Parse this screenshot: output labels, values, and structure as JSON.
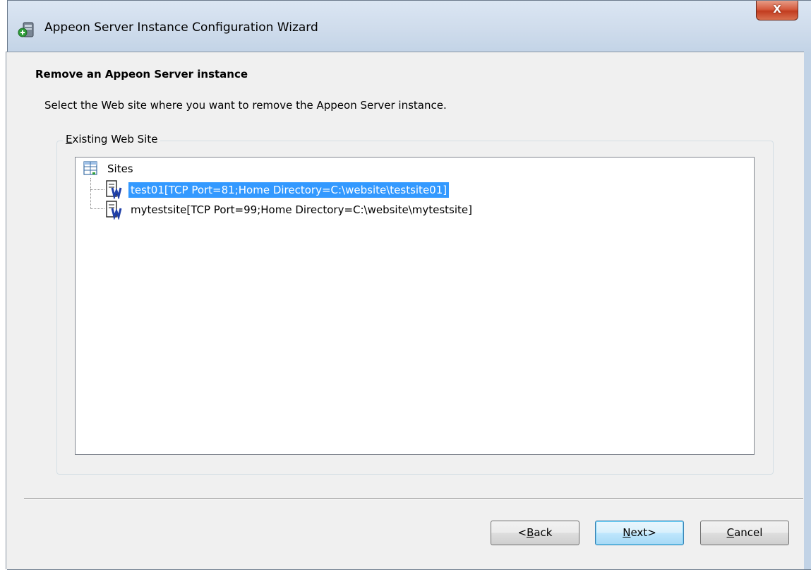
{
  "window": {
    "title": "Appeon Server Instance Configuration Wizard",
    "close_label": "X"
  },
  "step": {
    "title": "Remove an Appeon Server instance",
    "description": "Select the Web site where you want to remove the Appeon Server instance."
  },
  "group": {
    "legend_mnemonic": "E",
    "legend_rest": "xisting Web Site"
  },
  "tree": {
    "root_label": "Sites",
    "nodes": [
      {
        "label": "test01[TCP Port=81;Home Directory=C:\\website\\testsite01]",
        "selected": true
      },
      {
        "label": "mytestsite[TCP Port=99;Home Directory=C:\\website\\mytestsite]",
        "selected": false
      }
    ]
  },
  "buttons": {
    "back_prefix": "<",
    "back_mnemonic": "B",
    "back_rest": "ack",
    "next_mnemonic": "N",
    "next_rest": "ext>",
    "cancel_mnemonic": "C",
    "cancel_rest": "ancel"
  },
  "colors": {
    "selection": "#3399ff",
    "close_button": "#c94a2c"
  }
}
